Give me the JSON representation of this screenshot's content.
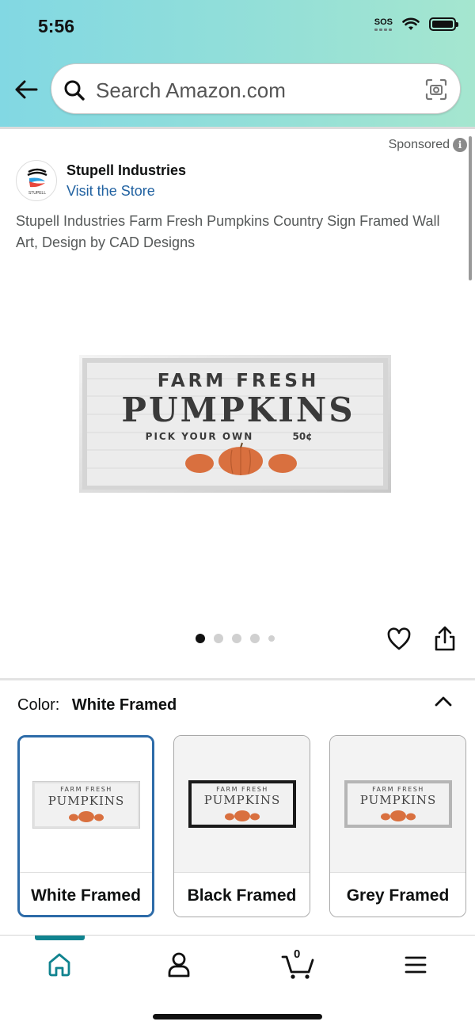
{
  "status_bar": {
    "time": "5:56",
    "sos": "SOS"
  },
  "search": {
    "placeholder": "Search Amazon.com"
  },
  "product": {
    "sponsored": "Sponsored",
    "brand": "Stupell Industries",
    "visit_store": "Visit the Store",
    "logo_text": "STUPELL",
    "title": "Stupell Industries Farm Fresh Pumpkins Country Sign Framed Wall Art, Design by CAD Designs",
    "image_text": {
      "line1": "FARM FRESH",
      "line2": "PUMPKINS",
      "line3": "PICK YOUR OWN",
      "price": "50¢"
    },
    "image_count": 5,
    "active_image_index": 0
  },
  "color_selector": {
    "label": "Color:",
    "selected": "White Framed",
    "options": [
      {
        "label": "White Framed",
        "frame_color": "#e8e8e8",
        "selected": true
      },
      {
        "label": "Black Framed",
        "frame_color": "#1a1a1a",
        "selected": false
      },
      {
        "label": "Grey Framed",
        "frame_color": "#b5b5b5",
        "selected": false
      }
    ]
  },
  "bottom_nav": {
    "items": [
      "home-icon",
      "account-icon",
      "cart-icon",
      "menu-icon"
    ],
    "cart_count": "0",
    "active_color": "#10838f"
  },
  "colors": {
    "link": "#2162a1",
    "pumpkin": "#d9703f",
    "selected_border": "#2d6ba8"
  }
}
